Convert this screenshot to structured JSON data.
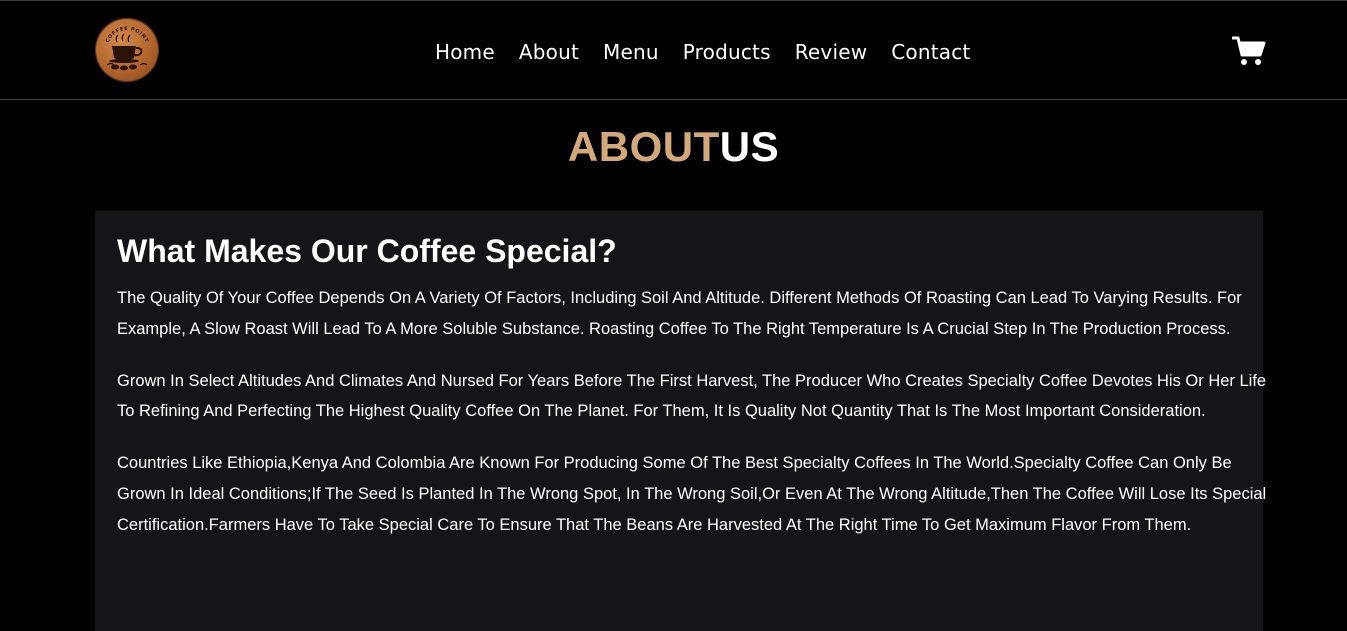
{
  "header": {
    "logo_text": "COFFEE POINT",
    "nav": [
      {
        "label": "Home"
      },
      {
        "label": "About"
      },
      {
        "label": "Menu"
      },
      {
        "label": "Products"
      },
      {
        "label": "Review"
      },
      {
        "label": "Contact"
      }
    ],
    "cart_icon": "shopping-cart-icon"
  },
  "section": {
    "title_accent": "ABOUT",
    "title_rest": "US"
  },
  "about": {
    "heading": "What Makes Our Coffee Special?",
    "paragraphs": [
      "The Quality Of Your Coffee Depends On A Variety Of Factors, Including Soil And Altitude. Different Methods Of Roasting Can Lead To Varying Results. For Example, A Slow Roast Will Lead To A More Soluble Substance. Roasting Coffee To The Right Temperature Is A Crucial Step In The Production Process.",
      "Grown In Select Altitudes And Climates And Nursed For Years Before The First Harvest, The Producer Who Creates Specialty Coffee Devotes His Or Her Life To Refining And Perfecting The Highest Quality Coffee On The Planet. For Them, It Is Quality Not Quantity That Is The Most Important Consideration.",
      "Countries Like Ethiopia,Kenya And Colombia Are Known For Producing Some Of The Best Specialty Coffees In The World.Specialty Coffee Can Only Be Grown In Ideal Conditions;If The Seed Is Planted In The Wrong Spot, In The Wrong Soil,Or Even At The Wrong Altitude,Then The Coffee Will Lose Its Special Certification.Farmers Have To Take Special Care To Ensure That The Beans Are Harvested At The Right Time To Get Maximum Flavor From Them."
    ]
  },
  "colors": {
    "accent": "#d3a979",
    "background": "#000000",
    "card": "#141519",
    "text": "#ffffff"
  }
}
